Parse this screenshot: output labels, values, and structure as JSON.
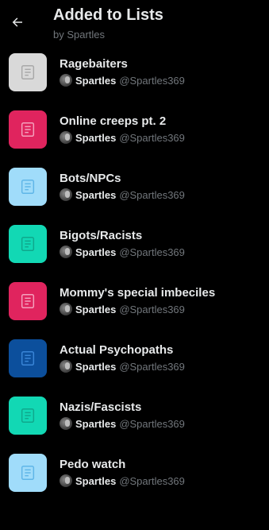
{
  "header": {
    "title": "Added to Lists",
    "subtitle": "by Spartles",
    "back_icon": "arrow-left-icon"
  },
  "colors": {
    "background": "#000000",
    "text_primary": "#e7e9ea",
    "text_secondary": "#71767b"
  },
  "lists": [
    {
      "name": "Ragebaiters",
      "owner": "Spartles",
      "handle": "@Spartles369",
      "icon_bg": "#d9d9d9",
      "icon_fg": "#a8a8a8"
    },
    {
      "name": "Online creeps pt. 2",
      "owner": "Spartles",
      "handle": "@Spartles369",
      "icon_bg": "#e0245e",
      "icon_fg": "#f4a2bd"
    },
    {
      "name": "Bots/NPCs",
      "owner": "Spartles",
      "handle": "@Spartles369",
      "icon_bg": "#a0dcfa",
      "icon_fg": "#5fb6e8"
    },
    {
      "name": "Bigots/Racists",
      "owner": "Spartles",
      "handle": "@Spartles369",
      "icon_bg": "#12d8b4",
      "icon_fg": "#0fa88c"
    },
    {
      "name": "Mommy's special imbeciles",
      "owner": "Spartles",
      "handle": "@Spartles369",
      "icon_bg": "#e0245e",
      "icon_fg": "#f4a2bd"
    },
    {
      "name": "Actual Psychopaths",
      "owner": "Spartles",
      "handle": "@Spartles369",
      "icon_bg": "#0c4f9c",
      "icon_fg": "#3a86d8"
    },
    {
      "name": "Nazis/Fascists",
      "owner": "Spartles",
      "handle": "@Spartles369",
      "icon_bg": "#12d8b4",
      "icon_fg": "#0fa88c"
    },
    {
      "name": "Pedo watch",
      "owner": "Spartles",
      "handle": "@Spartles369",
      "icon_bg": "#a0dcfa",
      "icon_fg": "#5fb6e8"
    }
  ]
}
